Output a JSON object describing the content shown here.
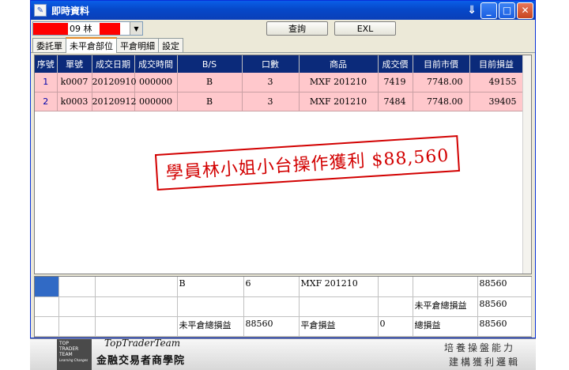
{
  "window": {
    "title": "即時資料",
    "buttons": {
      "pin": "⇓",
      "minimize": "_",
      "maximize": "□",
      "close": "✕"
    }
  },
  "toolbar": {
    "account_value": "09 林",
    "query_label": "查詢",
    "exl_label": "EXL"
  },
  "tabs": [
    {
      "label": "委託單"
    },
    {
      "label": "未平倉部位"
    },
    {
      "label": "平倉明細"
    },
    {
      "label": "設定"
    }
  ],
  "grid": {
    "columns": [
      "序號",
      "單號",
      "成交日期",
      "成交時間",
      "B/S",
      "口數",
      "商品",
      "成交價",
      "目前市價",
      "目前損益"
    ],
    "rows": [
      [
        "1",
        "k0007",
        "20120910",
        "000000",
        "B",
        "3",
        "MXF 201210",
        "7419",
        "7748.00",
        "49155"
      ],
      [
        "2",
        "k0003",
        "20120912",
        "000000",
        "B",
        "3",
        "MXF 201210",
        "7484",
        "7748.00",
        "39405"
      ]
    ]
  },
  "stamp": {
    "text": "學員林小姐小台操作獲利 $88,560"
  },
  "summary": {
    "rows": [
      [
        "",
        "",
        "",
        "B",
        "6",
        "MXF 201210",
        "",
        "",
        "88560"
      ],
      [
        "",
        "",
        "",
        "",
        "",
        "",
        "",
        "未平倉總損益",
        "88560"
      ],
      [
        "",
        "",
        "",
        "未平倉總損益",
        "88560",
        "平倉損益",
        "0",
        "總損益",
        "88560"
      ]
    ]
  },
  "footer": {
    "logo_line1": "TOP",
    "logo_line2": "TRADER",
    "logo_line3": "TEAM",
    "logo_sub": "Learning Changes",
    "team_name": "TopTraderTeam",
    "college_name": "金融交易者商學院",
    "slogan_line1": "培養操盤能力",
    "slogan_line2": "建構獲利邏輯"
  },
  "colors": {
    "header_bg": "#0b2a7a",
    "row_bg": "#ffc8cc",
    "stamp": "#d20000",
    "selection": "#316ac5"
  }
}
